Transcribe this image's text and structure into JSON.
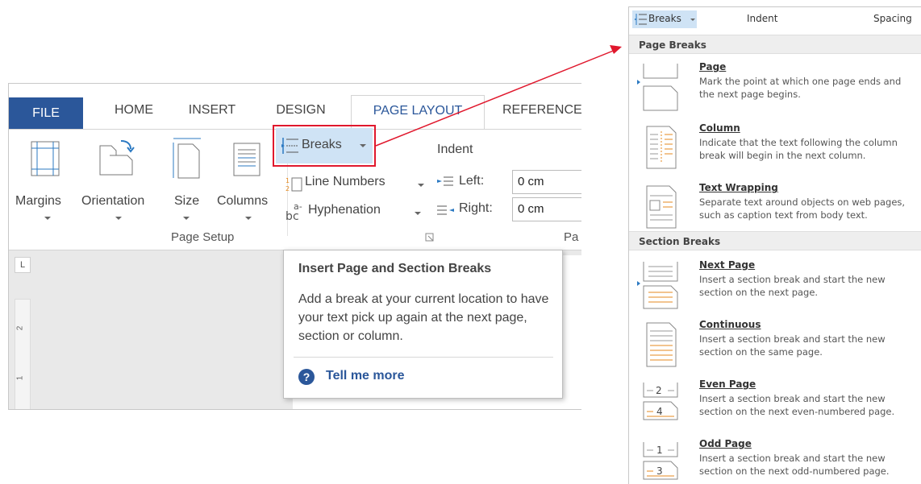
{
  "ribbon": {
    "tabs": [
      "FILE",
      "HOME",
      "INSERT",
      "DESIGN",
      "PAGE LAYOUT",
      "REFERENCE"
    ],
    "buttons": {
      "margins": "Margins",
      "orientation": "Orientation",
      "size": "Size",
      "columns": "Columns",
      "breaks": "Breaks",
      "line_numbers": "Line Numbers",
      "hyphenation": "Hyphenation"
    },
    "group_label": "Page Setup",
    "paragraph_partial": "Pa",
    "indent": {
      "title": "Indent",
      "left_label": "Left:",
      "left_value": "0 cm",
      "right_label": "Right:",
      "right_value": "0 cm"
    },
    "ruler_marks": [
      "2",
      "1"
    ]
  },
  "tooltip": {
    "title": "Insert Page and Section Breaks",
    "body": "Add a break at your current location to have your text pick up again at the next page, section or column.",
    "help_icon": "?",
    "link": "Tell me more"
  },
  "menu": {
    "topbar": {
      "breaks": "Breaks",
      "indent": "Indent",
      "spacing": "Spacing"
    },
    "page_breaks_header": "Page Breaks",
    "section_breaks_header": "Section Breaks",
    "page_items": [
      {
        "title": "Page",
        "desc": "Mark the point at which one page ends and the next page begins.",
        "icon": "page-break-icon"
      },
      {
        "title": "Column",
        "desc": "Indicate that the text following the column break will begin in the next column.",
        "icon": "column-break-icon"
      },
      {
        "title": "Text Wrapping",
        "desc": "Separate text around objects on web pages, such as caption text from body text.",
        "icon": "text-wrapping-icon"
      }
    ],
    "section_items": [
      {
        "title": "Next Page",
        "desc": "Insert a section break and start the new section on the next page.",
        "icon": "next-page-icon"
      },
      {
        "title": "Continuous",
        "desc": "Insert a section break and start the new section on the same page.",
        "icon": "continuous-icon"
      },
      {
        "title": "Even Page",
        "desc": "Insert a section break and start the new section on the next even-numbered page.",
        "icon": "even-page-icon",
        "glyph_top": "2",
        "glyph_bottom": "4"
      },
      {
        "title": "Odd Page",
        "desc": "Insert a section break and start the new section on the next odd-numbered page.",
        "icon": "odd-page-icon",
        "glyph_top": "1",
        "glyph_bottom": "3"
      }
    ]
  },
  "colors": {
    "accent_blue": "#2b579a",
    "highlight_red": "#e0182d",
    "hover_blue": "#cfe3f5",
    "icon_orange": "#e58a1f"
  }
}
